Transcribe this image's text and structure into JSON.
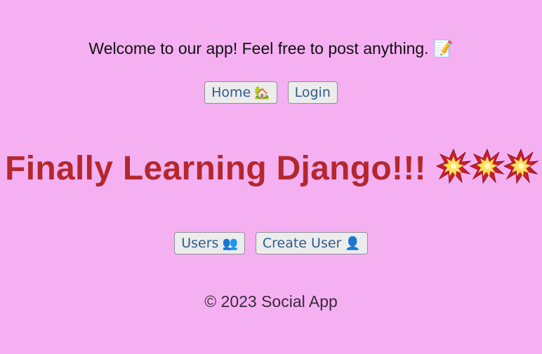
{
  "header": {
    "welcome_text": "Welcome to our app! Feel free to post anything.",
    "welcome_icon": "memo-icon",
    "welcome_glyph": "📝"
  },
  "nav_top": {
    "home_label": "Home",
    "home_icon": "house-icon",
    "home_glyph": "🏡",
    "login_label": "Login"
  },
  "main": {
    "headline": "Finally Learning Django!!!",
    "headline_icons": [
      "collision-icon",
      "collision-icon",
      "collision-icon"
    ]
  },
  "nav_bottom": {
    "users_label": "Users",
    "users_icon": "users-icon",
    "users_glyph": "👥",
    "create_user_label": "Create User",
    "create_user_icon": "user-icon",
    "create_user_glyph": "👤"
  },
  "footer": {
    "text": "© 2023 Social App"
  },
  "colors": {
    "background": "#f5b0f2",
    "headline": "#b3282d",
    "button_text": "#2d5b8a"
  }
}
